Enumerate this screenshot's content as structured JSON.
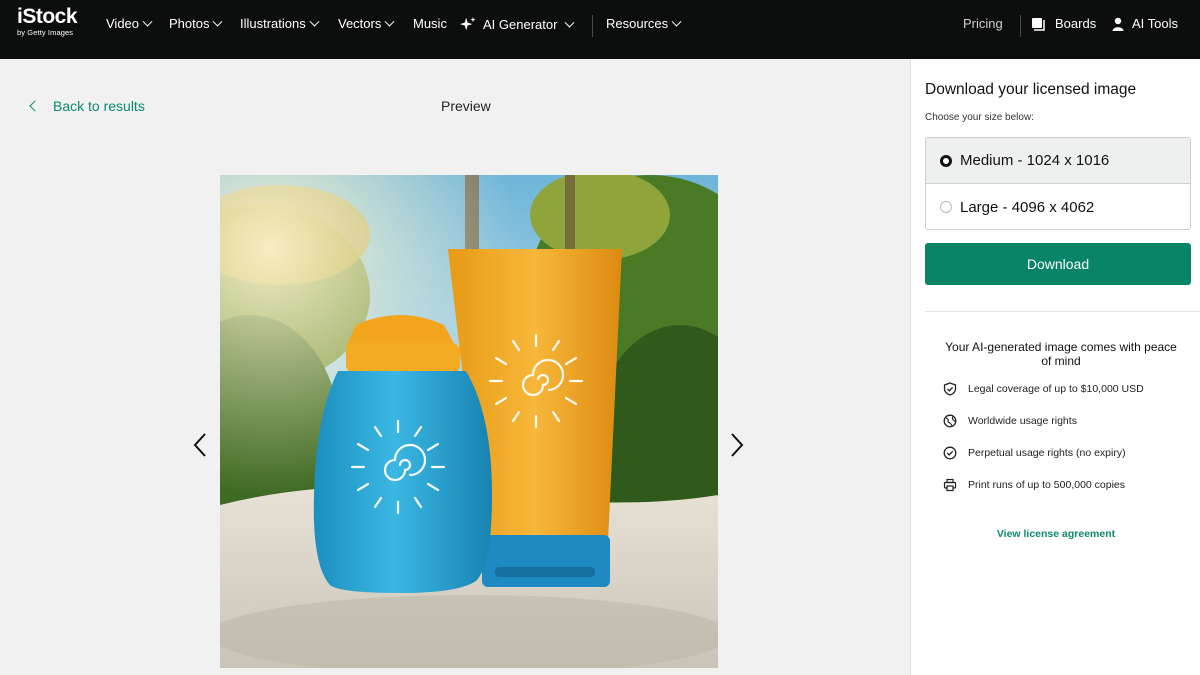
{
  "brand": {
    "name": "iStock",
    "sub": "by Getty Images"
  },
  "nav": {
    "video": "Video",
    "photos": "Photos",
    "illustrations": "Illustrations",
    "vectors": "Vectors",
    "music": "Music",
    "ai_generator": "AI Generator",
    "resources": "Resources",
    "pricing": "Pricing",
    "boards": "Boards",
    "ai_tools": "AI Tools"
  },
  "main": {
    "back_label": "Back to results",
    "preview_label": "Preview"
  },
  "panel": {
    "title": "Download your licensed image",
    "subtitle": "Choose your size below:",
    "sizes": [
      {
        "label": "Medium - 1024 x 1016",
        "selected": true
      },
      {
        "label": "Large - 4096 x 4062",
        "selected": false
      }
    ],
    "download_label": "Download",
    "peace_title": "Your AI-generated image comes with peace of mind",
    "features": [
      {
        "icon": "shield-icon",
        "text": "Legal coverage of up to $10,000 USD"
      },
      {
        "icon": "globe-icon",
        "text": "Worldwide usage rights"
      },
      {
        "icon": "check-circle-icon",
        "text": "Perpetual usage rights (no expiry)"
      },
      {
        "icon": "printer-icon",
        "text": "Print runs of up to 500,000 copies"
      }
    ],
    "license_link": "View license agreement"
  },
  "colors": {
    "accent": "#088466",
    "link": "#0c8a6c",
    "nav_bg": "#0c0d0d"
  }
}
